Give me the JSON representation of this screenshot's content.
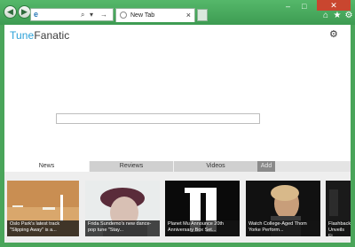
{
  "browser": {
    "address_bar": {
      "icon": "ie-page-icon",
      "search_glyph": "⌕",
      "dropdown_glyph": "▾",
      "refresh_glyph": "→"
    },
    "tabs": [
      {
        "label": "New Tab",
        "close_glyph": "×",
        "status_icon": "loading-spinner-icon"
      }
    ],
    "window_controls": {
      "minimize": "–",
      "maximize": "□",
      "close": "✕"
    },
    "toolbar_icons": [
      "home-icon",
      "favorites-star-icon",
      "tools-gear-icon"
    ],
    "toolbar_glyphs": {
      "home": "⌂",
      "favorites": "★",
      "tools": "⚙"
    },
    "nav_glyphs": {
      "back": "◀",
      "forward": "▶"
    }
  },
  "page": {
    "logo": {
      "part1": "Tune",
      "part2": "Fanatic",
      "colors": {
        "part1": "#2aa0d8",
        "part2": "#3b3b3b"
      }
    },
    "settings_glyph": "⚙",
    "search": {
      "value": "",
      "placeholder": ""
    },
    "content_tabs": [
      {
        "label": "News",
        "active": true
      },
      {
        "label": "Reviews",
        "active": false
      },
      {
        "label": "Videos",
        "active": false
      }
    ],
    "add_tab_label": "Add",
    "news_tiles": [
      {
        "caption": "Oslo Park's latest track \"Slipping Away\" is a..."
      },
      {
        "caption": "Frida Sundemo's new dance-pop tune \"Stay..."
      },
      {
        "caption": "Planet Mu Announce 20th Anniversary Box Set..."
      },
      {
        "caption": "Watch College-Aged Thom Yorke Perform..."
      },
      {
        "caption": "Flashback Unveils Fi..."
      }
    ]
  }
}
